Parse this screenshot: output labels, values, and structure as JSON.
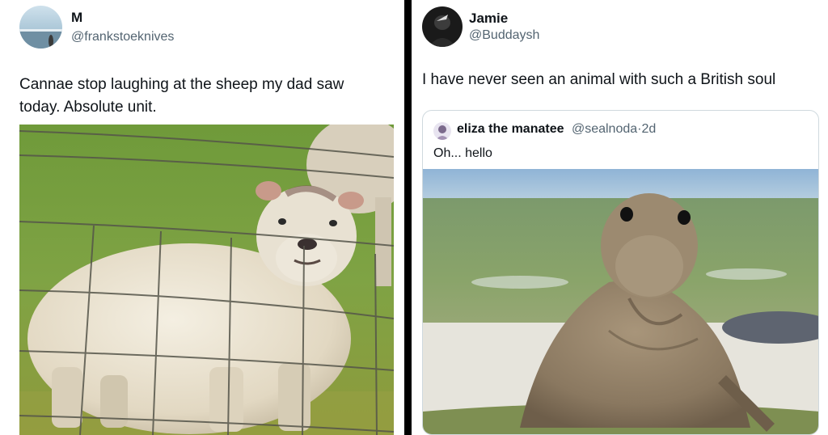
{
  "left_tweet": {
    "display_name": "M",
    "handle": "@frankstoeknives",
    "text_line1": "Cannae stop laughing at the sheep my dad saw",
    "text_line2": "today. Absolute unit.",
    "avatar_icon": "beach-horizon-avatar-icon",
    "photo_icon": "sheep-behind-fence-photo"
  },
  "right_tweet": {
    "display_name": "Jamie",
    "handle": "@Buddaysh",
    "text": "I have never seen an animal with such a British soul",
    "avatar_icon": "dark-silhouette-avatar-icon",
    "quote": {
      "display_name": "eliza the manatee",
      "handle": "@sealnoda",
      "separator": "·",
      "time": "2d",
      "text": "Oh... hello",
      "avatar_icon": "illustrated-avatar-icon",
      "photo_icon": "elephant-seal-photo"
    }
  },
  "colors": {
    "text_primary": "#0f1419",
    "text_secondary": "#536471",
    "border": "#cfd9de",
    "background": "#ffffff",
    "separator": "#000000"
  }
}
